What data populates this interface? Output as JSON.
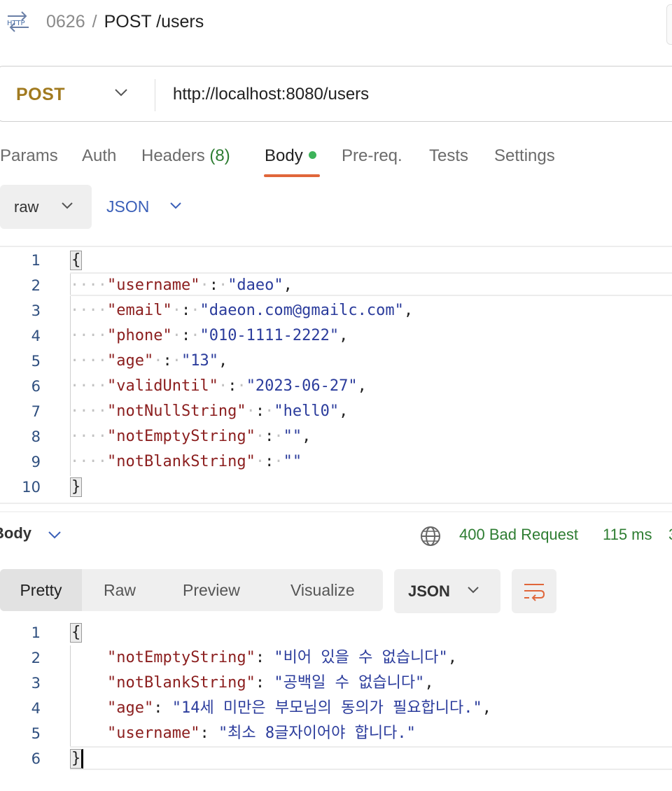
{
  "header": {
    "icon": "http-icon",
    "collection": "0626",
    "separator": "/",
    "request_name": "POST /users"
  },
  "request": {
    "method": "POST",
    "url": "http://localhost:8080/users"
  },
  "tabs": [
    {
      "label": "Params"
    },
    {
      "label": "Auth"
    },
    {
      "label": "Headers",
      "count": "(8)"
    },
    {
      "label": "Body",
      "active": true
    },
    {
      "label": "Pre-req."
    },
    {
      "label": "Tests"
    },
    {
      "label": "Settings"
    }
  ],
  "body_mode": {
    "type": "raw",
    "language": "JSON"
  },
  "request_body": {
    "line_numbers": [
      "1",
      "2",
      "3",
      "4",
      "5",
      "6",
      "7",
      "8",
      "9",
      "10"
    ],
    "open": "{",
    "close": "}",
    "fields": [
      {
        "key": "\"username\"",
        "value": "\"daeo\"",
        "comma": ","
      },
      {
        "key": "\"email\"",
        "value": "\"daeon.com@gmailc.com\"",
        "comma": ","
      },
      {
        "key": "\"phone\"",
        "value": "\"010-1111-2222\"",
        "comma": ","
      },
      {
        "key": "\"age\"",
        "value": "\"13\"",
        "comma": ","
      },
      {
        "key": "\"validUntil\"",
        "value": "\"2023-06-27\"",
        "comma": ","
      },
      {
        "key": "\"notNullString\"",
        "value": "\"hell0\"",
        "comma": ","
      },
      {
        "key": "\"notEmptyString\"",
        "value": "\"\"",
        "comma": ","
      },
      {
        "key": "\"notBlankString\"",
        "value": "\"\"",
        "comma": ""
      }
    ]
  },
  "response": {
    "section_label": "Body",
    "status": "400 Bad Request",
    "time": "115 ms",
    "size_fragment": "3",
    "view_tabs": [
      "Pretty",
      "Raw",
      "Preview",
      "Visualize"
    ],
    "active_view": "Pretty",
    "language": "JSON",
    "line_numbers": [
      "1",
      "2",
      "3",
      "4",
      "5",
      "6"
    ],
    "open": "{",
    "close": "}",
    "fields": [
      {
        "key": "\"notEmptyString\"",
        "value": "\"비어 있을 수 없습니다\"",
        "comma": ","
      },
      {
        "key": "\"notBlankString\"",
        "value": "\"공백일 수 없습니다\"",
        "comma": ","
      },
      {
        "key": "\"age\"",
        "value": "\"14세 미만은 부모님의 동의가 필요합니다.\"",
        "comma": ","
      },
      {
        "key": "\"username\"",
        "value": "\"최소 8글자이어야 합니다.\"",
        "comma": ""
      }
    ]
  },
  "colors": {
    "method": "#a17a1f",
    "accent_underline": "#e0663a",
    "status_ok_green": "#2e7d32",
    "json_key": "#8b1e1e",
    "json_string": "#2b3c9c"
  }
}
